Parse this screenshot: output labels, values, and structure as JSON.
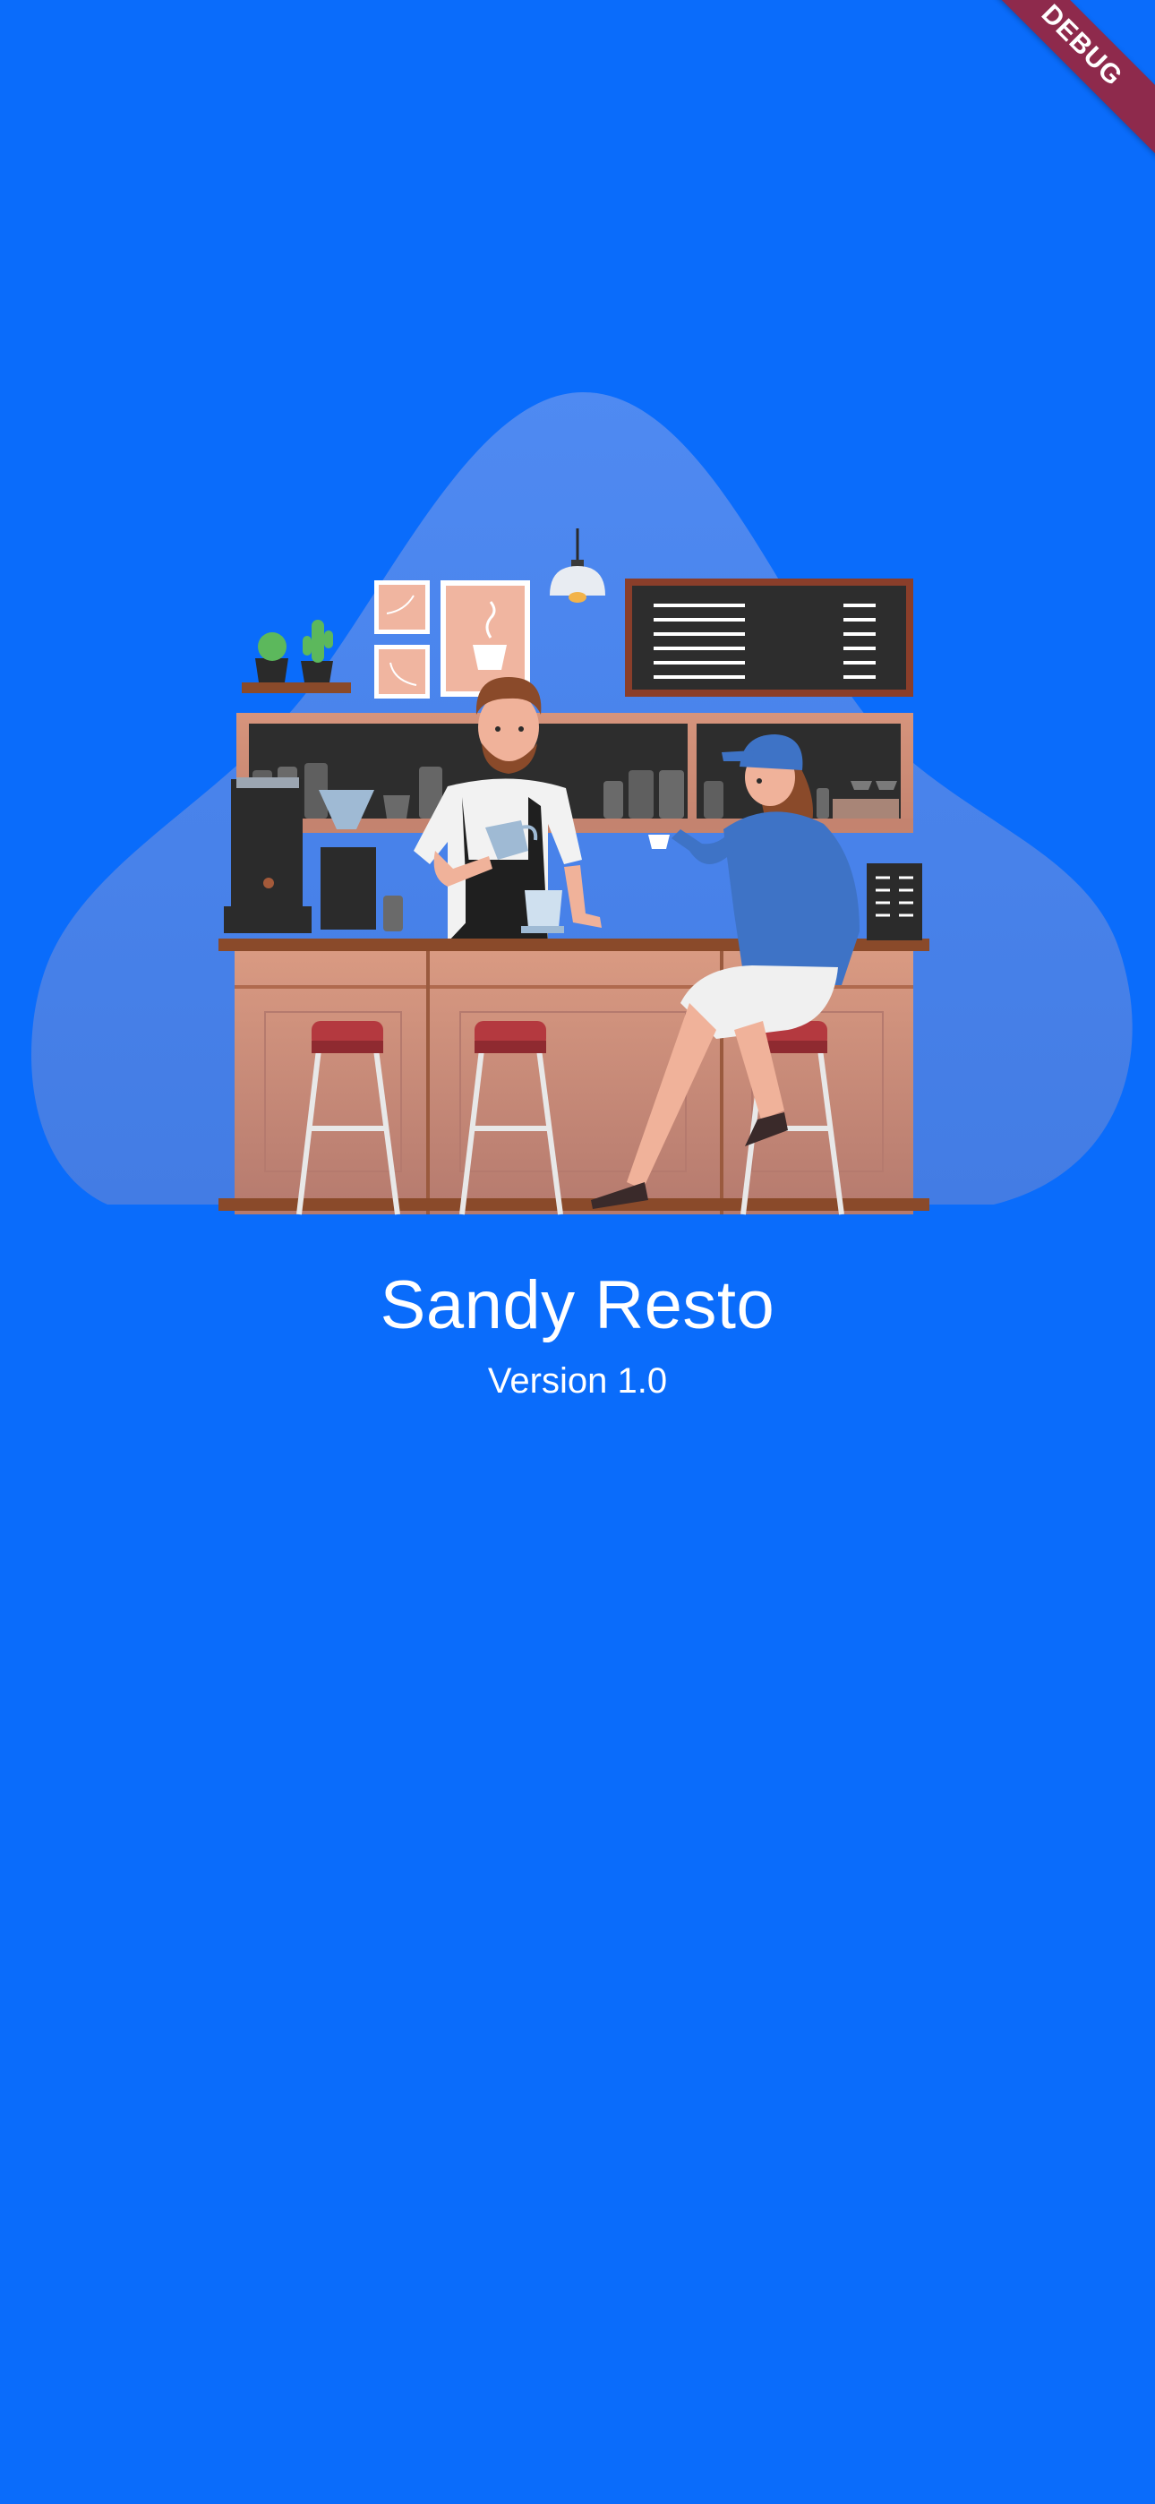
{
  "app": {
    "title": "Sandy Resto",
    "version": "Version 1.0"
  },
  "debug_banner": {
    "label": "DEBUG"
  },
  "illustration": {
    "icon": "cafe-barista-illustration",
    "description_icon_names": [
      "blob-background",
      "barista",
      "customer",
      "counter",
      "bar-stools",
      "menu-board",
      "pendant-lamp",
      "cactus-plants",
      "espresso-machine"
    ]
  },
  "colors": {
    "background": "#0a6cfb",
    "blob": "#5a8fe4",
    "debug_banner": "#8e2a4c",
    "text": "#ffffff"
  }
}
